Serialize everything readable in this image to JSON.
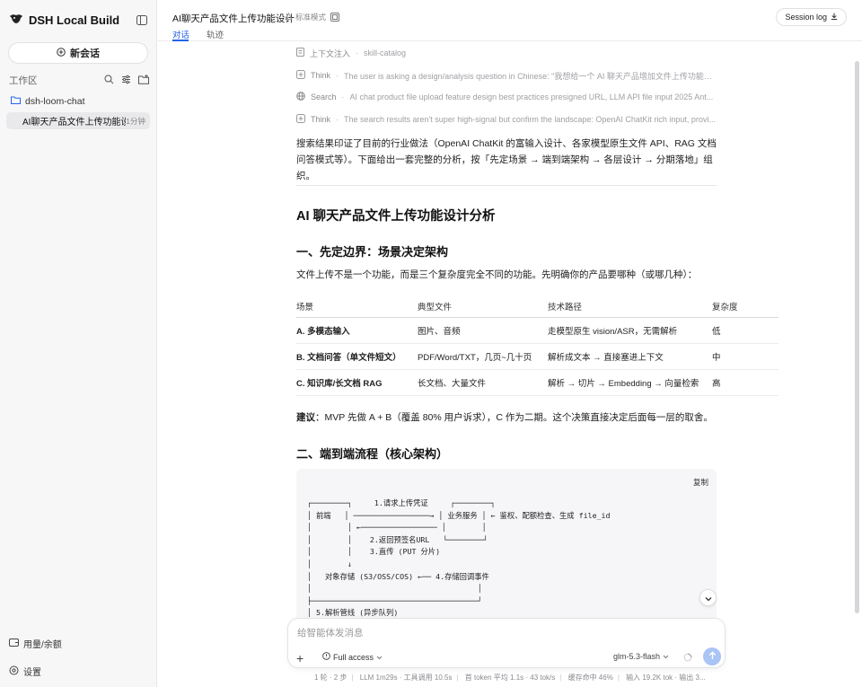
{
  "app": {
    "title": "DSH Local Build"
  },
  "sidebar": {
    "new_chat_label": "新会话",
    "workspace_label": "工作区",
    "project": "dsh-loom-chat",
    "conversation": {
      "title": "AI聊天产品文件上传功能设计",
      "time": "1分钟"
    },
    "usage_label": "用量/余额",
    "settings_label": "设置"
  },
  "header": {
    "title": "AI聊天产品文件上传功能设计",
    "mode": "标准模式",
    "tabs": [
      {
        "label": "对话"
      },
      {
        "label": "轨迹"
      }
    ],
    "session_log_label": "Session log"
  },
  "steps": [
    {
      "label": "上下文注入",
      "detail": "skill-catalog"
    },
    {
      "label": "Think",
      "detail": "The user is asking a design/analysis question in Chinese: \"我想给一个 AI 聊天产品增加文件上传功能，..."
    },
    {
      "label": "Search",
      "detail": "AI chat product file upload feature design best practices presigned URL, LLM API file input 2025 Ant..."
    },
    {
      "label": "Think",
      "detail": "The search results aren't super high-signal but confirm the landscape: OpenAI ChatKit rich input, provi..."
    }
  ],
  "content": {
    "intro": "搜索结果印证了目前的行业做法（OpenAI ChatKit 的富输入设计、各家模型原生文件 API、RAG 文档问答模式等）。下面给出一套完整的分析，按「先定场景 → 端到端架构 → 各层设计 → 分期落地」组织。",
    "h1": "AI 聊天产品文件上传功能设计分析",
    "section1_title": "一、先定边界：场景决定架构",
    "section1_para": "文件上传不是一个功能，而是三个复杂度完全不同的功能。先明确你的产品要哪种（或哪几种）：",
    "table": {
      "headers": [
        "场景",
        "典型文件",
        "技术路径",
        "复杂度"
      ],
      "rows": [
        [
          "A. 多模态输入",
          "图片、音频",
          "走模型原生 vision/ASR，无需解析",
          "低"
        ],
        [
          "B. 文档问答（单文件短文）",
          "PDF/Word/TXT，几页~几十页",
          "解析成文本 → 直接塞进上下文",
          "中"
        ],
        [
          "C. 知识库/长文档 RAG",
          "长文档、大量文件",
          "解析 → 切片 → Embedding → 向量检索",
          "高"
        ]
      ]
    },
    "suggestion_label": "建议",
    "suggestion_text": "：MVP 先做 A + B（覆盖 80% 用户诉求），C 作为二期。这个决策直接决定后面每一层的取舍。",
    "section2_title": "二、端到端流程（核心架构）",
    "copy_label": "复制",
    "code": "┌────────┐     1.请求上传凭证     ┌────────┐\n│ 前端   │ ─────────────────→ │ 业务服务 │ ← 鉴权、配额检查、生成 file_id\n│        │ ←───────────────── │        │\n│        │    2.返回预签名URL   └────────┘\n│        │    3.直传 (PUT 分片)\n│        ↓\n│   对象存储 (S3/OSS/COS) ←── 4.存储回调事件\n│                                     │\n├─────────────────────────────────────┘\n│ 5.解析管线 (异步队列)"
  },
  "composer": {
    "placeholder": "给智能体发消息",
    "access_label": "Full access",
    "model_label": "glm-5.3-flash"
  },
  "statusbar": [
    "1 轮 · 2 步",
    "LLM 1m29s · 工具调用 10.5s",
    "首 token 平均 1.1s · 43 tok/s",
    "缓存命中 46%",
    "输入 19.2K tok · 输出 3..."
  ]
}
